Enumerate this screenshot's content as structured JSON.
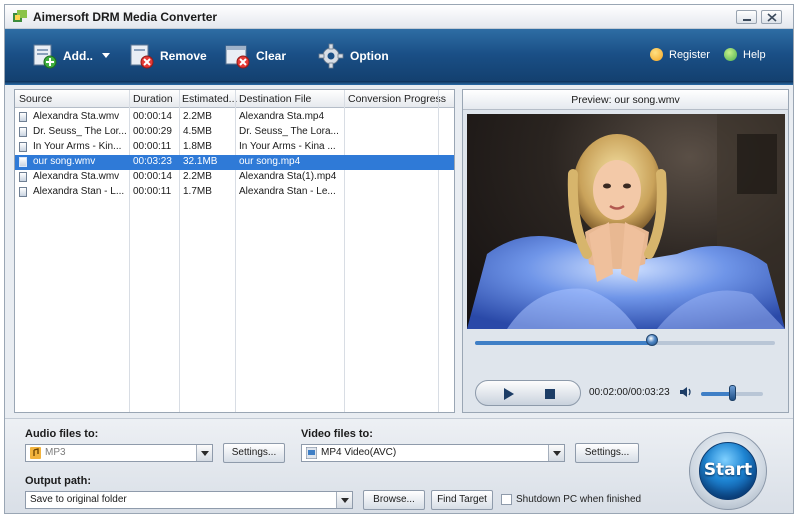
{
  "window": {
    "title": "Aimersoft DRM Media Converter"
  },
  "toolbar": {
    "add_label": "Add..",
    "remove_label": "Remove",
    "clear_label": "Clear",
    "option_label": "Option",
    "register_label": "Register",
    "help_label": "Help"
  },
  "filelist": {
    "columns": [
      "Source",
      "Duration",
      "Estimated...",
      "Destination File",
      "Conversion Progress"
    ],
    "rows": [
      {
        "source": "Alexandra Sta.wmv",
        "duration": "00:00:14",
        "estimated": "2.2MB",
        "destination": "Alexandra Sta.mp4",
        "progress": ""
      },
      {
        "source": "Dr. Seuss_ The Lor...",
        "duration": "00:00:29",
        "estimated": "4.5MB",
        "destination": "Dr. Seuss_ The Lora...",
        "progress": ""
      },
      {
        "source": "In Your Arms - Kin...",
        "duration": "00:00:11",
        "estimated": "1.8MB",
        "destination": "In Your Arms - Kina ...",
        "progress": ""
      },
      {
        "source": "our song.wmv",
        "duration": "00:03:23",
        "estimated": "32.1MB",
        "destination": "our song.mp4",
        "progress": ""
      },
      {
        "source": "Alexandra Sta.wmv",
        "duration": "00:00:14",
        "estimated": "2.2MB",
        "destination": "Alexandra Sta(1).mp4",
        "progress": ""
      },
      {
        "source": "Alexandra Stan - L...",
        "duration": "00:00:11",
        "estimated": "1.7MB",
        "destination": "Alexandra Stan - Le...",
        "progress": ""
      }
    ],
    "selected_index": 3
  },
  "preview": {
    "title": "Preview: our song.wmv",
    "time": "00:02:00/00:03:23",
    "seek_fraction": 0.59,
    "volume_fraction": 0.5
  },
  "bottom": {
    "audio_label": "Audio files to:",
    "audio_value": "MP3",
    "video_label": "Video files to:",
    "video_value": "MP4 Video(AVC)",
    "settings_label": "Settings...",
    "output_label": "Output path:",
    "output_value": "Save to original folder",
    "browse_label": "Browse...",
    "find_target_label": "Find Target",
    "shutdown_label": "Shutdown PC when finished",
    "start_label": "Start"
  },
  "colors": {
    "toolbar": "#1a4f86",
    "selection": "#2f7ad7",
    "start": "#1f86d4"
  }
}
